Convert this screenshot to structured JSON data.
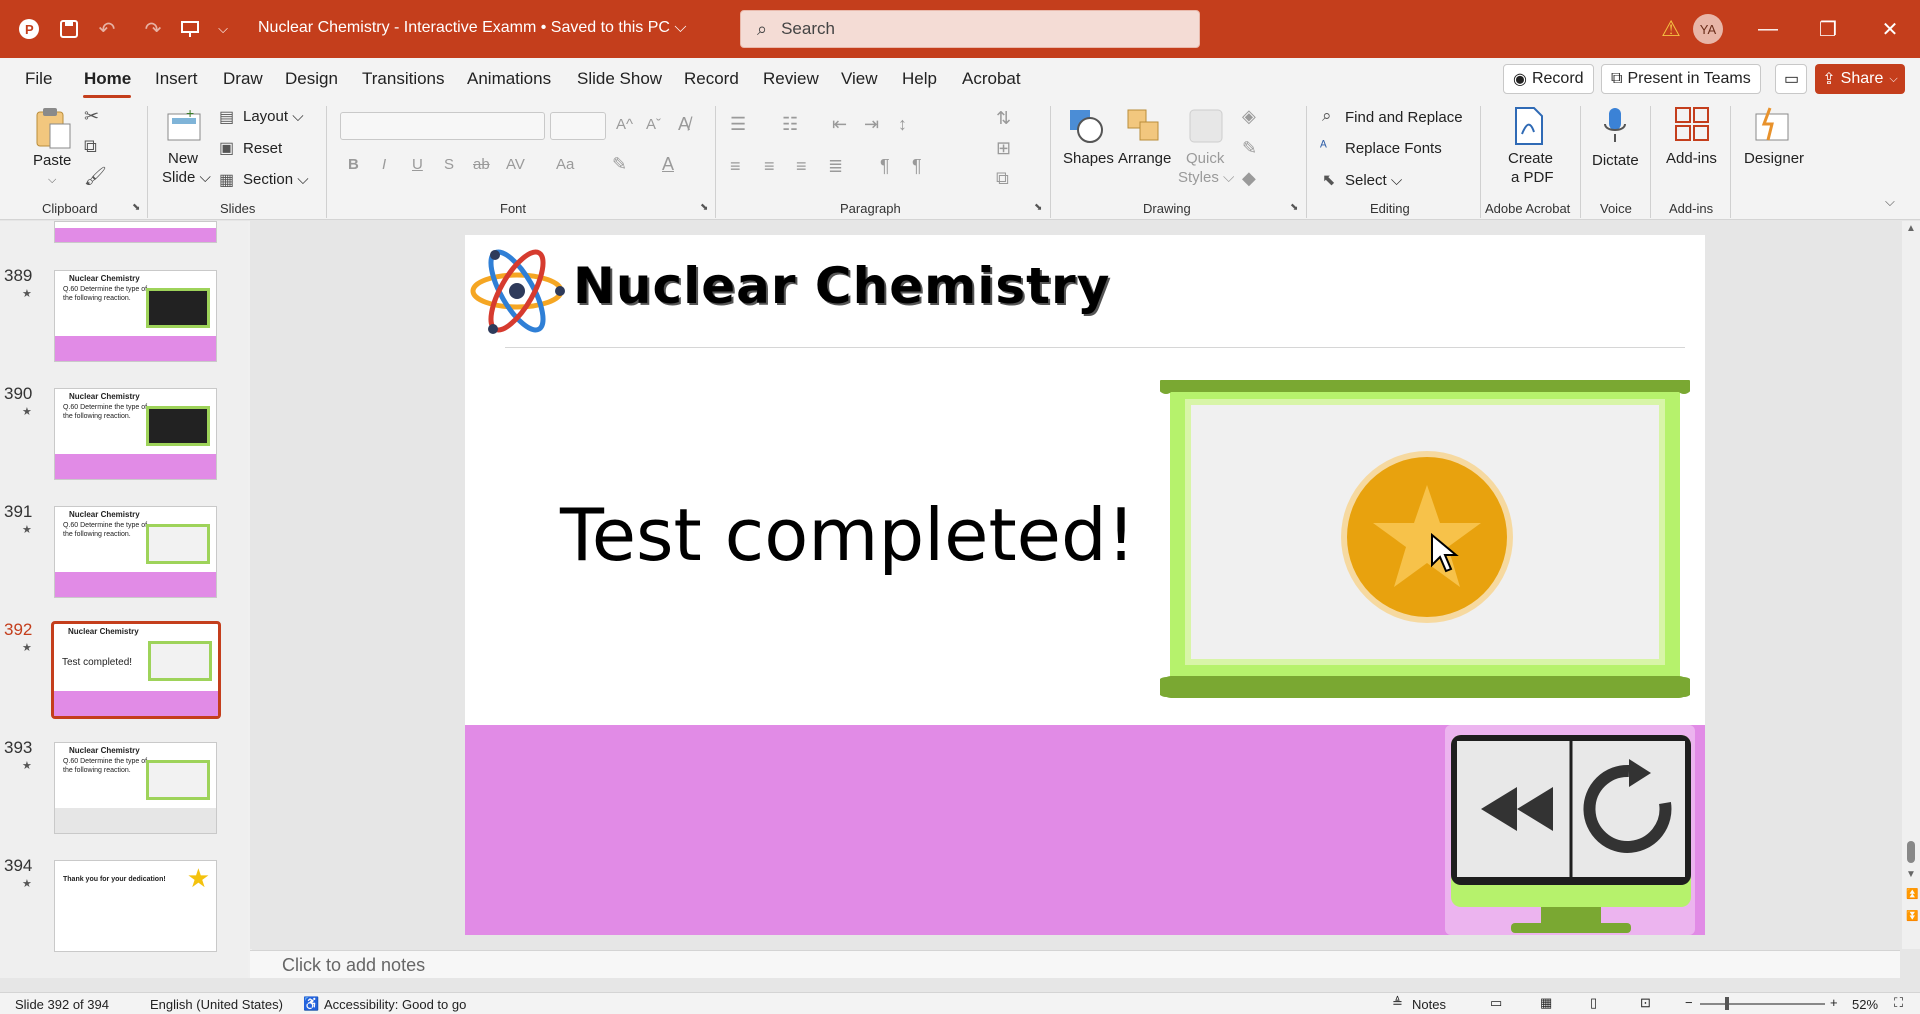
{
  "titlebar": {
    "doc_title": "Nuclear Chemistry - Interactive Examm • Saved to this PC ⌵",
    "search_placeholder": "Search",
    "user_initials": "YA",
    "warning_icon": "warning-icon",
    "brand_color": "#c43e1c"
  },
  "menu": {
    "tabs": [
      "File",
      "Home",
      "Insert",
      "Draw",
      "Design",
      "Transitions",
      "Animations",
      "Slide Show",
      "Record",
      "Review",
      "View",
      "Help",
      "Acrobat"
    ],
    "active_tab": "Home",
    "record_label": "Record",
    "present_label": "Present in Teams",
    "share_label": "Share"
  },
  "ribbon": {
    "clipboard": {
      "paste": "Paste",
      "label": "Clipboard"
    },
    "slides": {
      "new_slide_1": "New",
      "new_slide_2": "Slide ⌵",
      "layout": "Layout ⌵",
      "reset": "Reset",
      "section": "Section ⌵",
      "label": "Slides"
    },
    "font": {
      "label": "Font",
      "bold": "B",
      "italic": "I",
      "underline": "U",
      "shadow": "S",
      "strike": "ab",
      "spacing": "AV",
      "case": "Aa",
      "grow": "A^",
      "shrink": "Aˇ"
    },
    "paragraph": {
      "label": "Paragraph"
    },
    "drawing": {
      "shapes": "Shapes",
      "arrange": "Arrange",
      "quick_1": "Quick",
      "quick_2": "Styles ⌵",
      "label": "Drawing"
    },
    "editing": {
      "find_replace": "Find and Replace",
      "replace_fonts": "Replace Fonts",
      "select": "Select ⌵",
      "label": "Editing"
    },
    "acrobat": {
      "create_1": "Create",
      "create_2": "a PDF",
      "label": "Adobe Acrobat"
    },
    "voice": {
      "dictate": "Dictate",
      "label": "Voice"
    },
    "addins": {
      "addins": "Add-ins",
      "label": "Add-ins"
    },
    "designer": {
      "designer": "Designer"
    }
  },
  "thumbnails": [
    {
      "num": "389",
      "title": "Nuclear Chemistry",
      "text": "Q.60 Determine the type of the following reaction."
    },
    {
      "num": "390",
      "title": "Nuclear Chemistry",
      "text": "Q.60 Determine the type of the following reaction."
    },
    {
      "num": "391",
      "title": "Nuclear Chemistry",
      "text": "Q.60 Determine the type of the following reaction."
    },
    {
      "num": "392",
      "title": "Nuclear Chemistry",
      "text": "Test completed!"
    },
    {
      "num": "393",
      "title": "Nuclear Chemistry",
      "text": "Q.60 Determine the type of the following reaction."
    },
    {
      "num": "394",
      "title": "",
      "text": "Thank you for your dedication!"
    }
  ],
  "slide": {
    "title": "Nuclear Chemistry",
    "message": "Test completed!",
    "pink_color": "#e18be6",
    "frame_color": "#7aa832"
  },
  "notes": {
    "placeholder": "Click to add notes"
  },
  "status": {
    "slide_count": "Slide 392 of 394",
    "language": "English (United States)",
    "accessibility": "Accessibility: Good to go",
    "notes": "Notes",
    "zoom": "52%"
  }
}
